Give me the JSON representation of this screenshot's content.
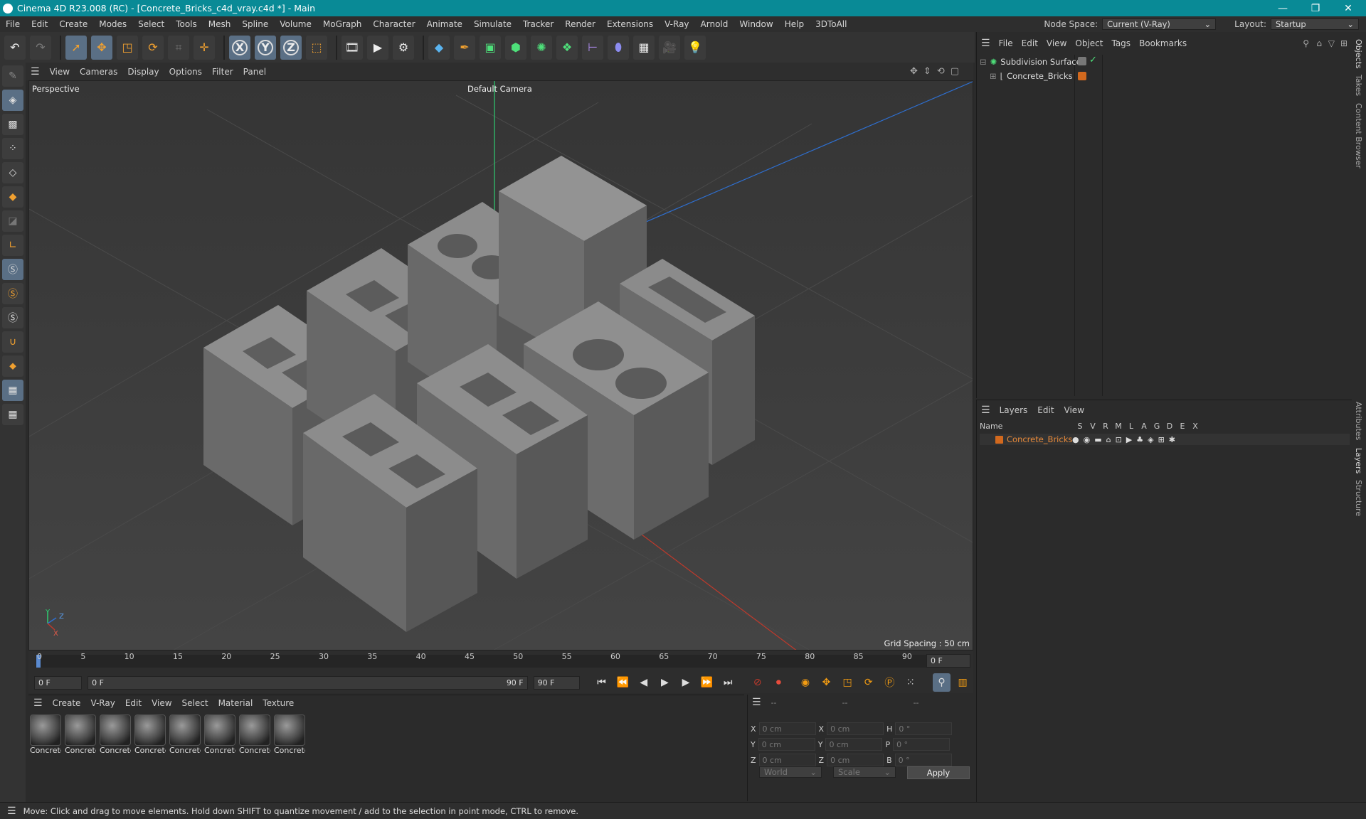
{
  "window": {
    "title": "Cinema 4D R23.008 (RC) - [Concrete_Bricks_c4d_vray.c4d *] - Main"
  },
  "menubar": {
    "items": [
      "File",
      "Edit",
      "Create",
      "Modes",
      "Select",
      "Tools",
      "Mesh",
      "Spline",
      "Volume",
      "MoGraph",
      "Character",
      "Animate",
      "Simulate",
      "Tracker",
      "Render",
      "Extensions",
      "V-Ray",
      "Arnold",
      "Window",
      "Help",
      "3DToAll"
    ],
    "node_space_label": "Node Space:",
    "node_space_value": "Current (V-Ray)",
    "layout_label": "Layout:",
    "layout_value": "Startup"
  },
  "toolbar": {
    "icons": [
      "undo-icon",
      "redo-icon",
      "select-icon",
      "move-icon",
      "scale-icon",
      "rotate-icon",
      "recent-icon",
      "add-icon",
      "x-axis-icon",
      "y-axis-icon",
      "z-axis-icon",
      "coordinate-system-icon",
      "render-region-icon",
      "render-view-icon",
      "render-settings-icon",
      "cube-icon",
      "pen-icon",
      "subdivide-icon",
      "extrude-icon",
      "array-icon",
      "cloner-icon",
      "deformer-icon",
      "sphere-icon",
      "floor-icon",
      "camera-icon",
      "light-icon"
    ],
    "axis_labels": [
      "X",
      "Y",
      "Z"
    ]
  },
  "viewport": {
    "menu": [
      "View",
      "Cameras",
      "Display",
      "Options",
      "Filter",
      "Panel"
    ],
    "view_name": "Perspective",
    "camera_name": "Default Camera",
    "grid_spacing": "Grid Spacing : 50 cm",
    "axis_x": "X",
    "axis_y": "Y",
    "axis_z": "Z"
  },
  "timeline": {
    "ticks": [
      "0",
      "5",
      "10",
      "15",
      "20",
      "25",
      "30",
      "35",
      "40",
      "45",
      "50",
      "55",
      "60",
      "65",
      "70",
      "75",
      "80",
      "85",
      "90"
    ],
    "current_frame": "0 F"
  },
  "playbar": {
    "start_frame": "0 F",
    "range_start": "0 F",
    "range_end": "90 F",
    "end_frame": "90 F"
  },
  "material_manager": {
    "menu": [
      "Create",
      "V-Ray",
      "Edit",
      "View",
      "Select",
      "Material",
      "Texture"
    ],
    "materials": [
      "Concrete",
      "Concrete",
      "Concrete",
      "Concrete",
      "Concrete",
      "Concrete",
      "Concrete",
      "Concrete"
    ]
  },
  "attributes": {
    "header": [
      "--",
      "--",
      "--"
    ],
    "rows": [
      {
        "a": "X",
        "av": "0 cm",
        "b": "X",
        "bv": "0 cm",
        "c": "H",
        "cv": "0 °"
      },
      {
        "a": "Y",
        "av": "0 cm",
        "b": "Y",
        "bv": "0 cm",
        "c": "P",
        "cv": "0 °"
      },
      {
        "a": "Z",
        "av": "0 cm",
        "b": "Z",
        "bv": "0 cm",
        "c": "B",
        "cv": "0 °"
      }
    ],
    "coord_system": "World",
    "mode": "Scale",
    "apply_label": "Apply"
  },
  "object_manager": {
    "menu": [
      "File",
      "Edit",
      "View",
      "Object",
      "Tags",
      "Bookmarks"
    ],
    "objects": [
      {
        "name": "Subdivision Surface"
      },
      {
        "name": "Concrete_Bricks"
      }
    ]
  },
  "layer_manager": {
    "menu": [
      "Layers",
      "Edit",
      "View"
    ],
    "columns": [
      "Name",
      "S",
      "V",
      "R",
      "M",
      "L",
      "A",
      "G",
      "D",
      "E",
      "X"
    ],
    "layers": [
      {
        "name": "Concrete_Bricks",
        "color": "#d2691e"
      }
    ]
  },
  "right_tabs": [
    "Objects",
    "Takes",
    "Content Browser",
    "Attributes",
    "Layers",
    "Structure"
  ],
  "status": {
    "text": "Move: Click and drag to move elements. Hold down SHIFT to quantize movement / add to the selection in point mode, CTRL to remove."
  }
}
